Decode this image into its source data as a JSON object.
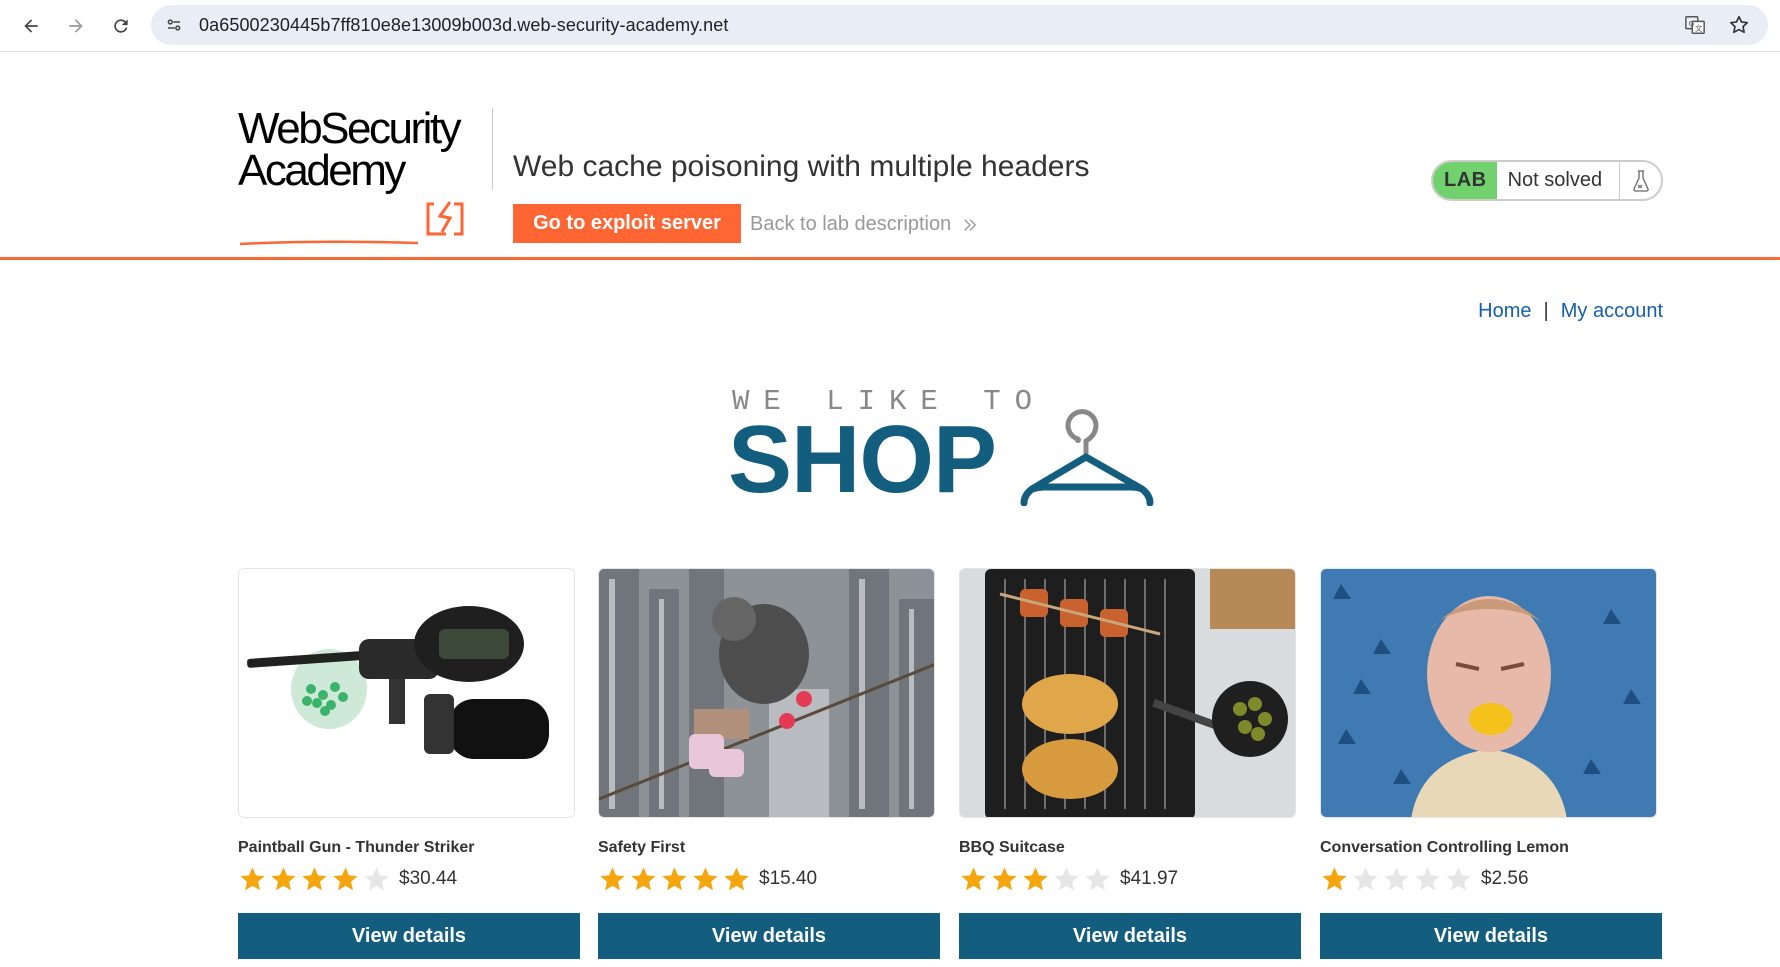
{
  "browser": {
    "url": "0a6500230445b7ff810e8e13009b003d.web-security-academy.net",
    "icons": [
      "back-icon",
      "forward-icon",
      "reload-icon",
      "site-info-icon",
      "translate-icon",
      "bookmark-star-icon"
    ]
  },
  "lab": {
    "logo_line1": "WebSecurity",
    "logo_line2": "Academy",
    "title": "Web cache poisoning with multiple headers",
    "exploit_button": "Go to exploit server",
    "back_link": "Back to lab description",
    "status_badge": "LAB",
    "status_text": "Not solved",
    "accent_color": "#ff6633",
    "badge_color": "#70d16d"
  },
  "nav": {
    "home": "Home",
    "separator": "|",
    "my_account": "My account"
  },
  "hero": {
    "small": "WE LIKE TO",
    "big": "SHOP",
    "color": "#135d7f"
  },
  "products": [
    {
      "name": "Paintball Gun - Thunder Striker",
      "rating": 4,
      "price": "$30.44",
      "button": "View details"
    },
    {
      "name": "Safety First",
      "rating": 5,
      "price": "$15.40",
      "button": "View details"
    },
    {
      "name": "BBQ Suitcase",
      "rating": 3,
      "price": "$41.97",
      "button": "View details"
    },
    {
      "name": "Conversation Controlling Lemon",
      "rating": 1,
      "price": "$2.56",
      "button": "View details"
    }
  ]
}
